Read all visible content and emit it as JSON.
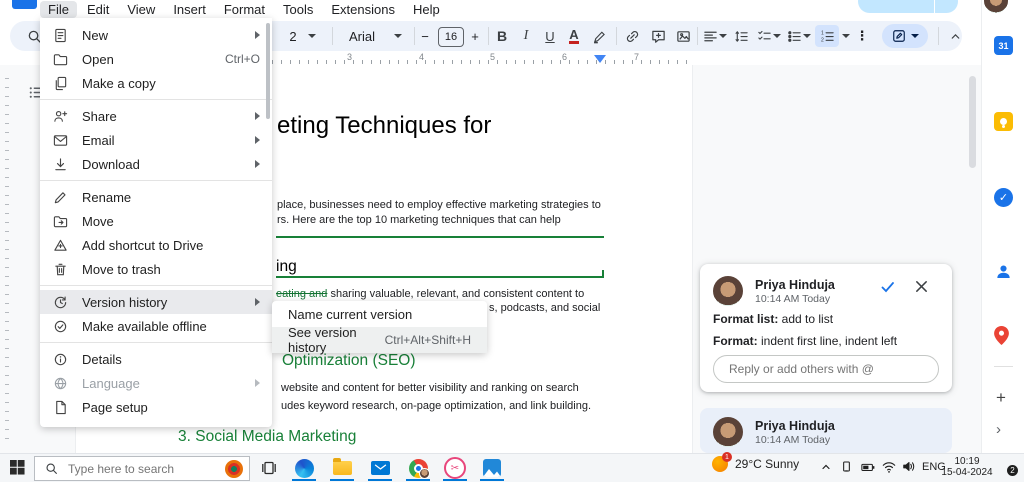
{
  "header": {
    "menu_items": [
      "File",
      "Edit",
      "View",
      "Insert",
      "Format",
      "Tools",
      "Extensions",
      "Help"
    ],
    "active_menu": "File"
  },
  "toolbar": {
    "style_value": "2",
    "font_name": "Arial",
    "font_size": "16",
    "minus_label": "−",
    "plus_label": "+",
    "bold_label": "B",
    "italic_label": "I",
    "underline_label": "U",
    "text_color_label": "A",
    "more_label": "⋮"
  },
  "ruler": {
    "marks": [
      "3",
      "4",
      "5",
      "6",
      "7"
    ]
  },
  "file_menu": {
    "items": [
      {
        "label": "New",
        "shortcut": "",
        "submenu": true
      },
      {
        "label": "Open",
        "shortcut": "Ctrl+O",
        "submenu": false
      },
      {
        "label": "Make a copy",
        "shortcut": "",
        "submenu": false
      },
      {
        "label": "Share",
        "shortcut": "",
        "submenu": true
      },
      {
        "label": "Email",
        "shortcut": "",
        "submenu": true
      },
      {
        "label": "Download",
        "shortcut": "",
        "submenu": true
      },
      {
        "label": "Rename",
        "shortcut": "",
        "submenu": false
      },
      {
        "label": "Move",
        "shortcut": "",
        "submenu": false
      },
      {
        "label": "Add shortcut to Drive",
        "shortcut": "",
        "submenu": false
      },
      {
        "label": "Move to trash",
        "shortcut": "",
        "submenu": false
      },
      {
        "label": "Version history",
        "shortcut": "",
        "submenu": true
      },
      {
        "label": "Make available offline",
        "shortcut": "",
        "submenu": false
      },
      {
        "label": "Details",
        "shortcut": "",
        "submenu": false
      },
      {
        "label": "Language",
        "shortcut": "",
        "submenu": true
      },
      {
        "label": "Page setup",
        "shortcut": "",
        "submenu": false
      }
    ],
    "highlighted_item": "Version history",
    "disabled_item": "Language"
  },
  "version_submenu": {
    "items": [
      {
        "label": "Name current version",
        "shortcut": ""
      },
      {
        "label": "See version history",
        "shortcut": "Ctrl+Alt+Shift+H"
      }
    ],
    "highlighted_item": "See version history"
  },
  "document": {
    "title_fragment": "eting Techniques for",
    "para1_line1": "place, businesses need to employ effective marketing strategies to",
    "para1_line2": "rs. Here are the top 10 marketing techniques that can help",
    "heading1_fragment": "ing",
    "strike_fragment": "eating and",
    "after_strike": " sharing valuable, relevant, and consistent content to",
    "body_line_fragment": "s, podcasts, and social",
    "heading2_fragment": "Optimization (SEO)",
    "para2_line1": "website and content for better visibility and ranking on search",
    "para2_line2": "udes keyword research, on-page optimization, and link building.",
    "heading3": "3. Social Media Marketing"
  },
  "comments": {
    "card1": {
      "author": "Priya Hinduja",
      "timestamp": "10:14 AM Today",
      "body_line1_bold": "Format list:",
      "body_line1_rest": " add to list",
      "body_line2_bold": "Format:",
      "body_line2_rest": " indent first line, indent left",
      "reply_placeholder": "Reply or add others with @"
    },
    "card2": {
      "author": "Priya Hinduja",
      "timestamp": "10:14 AM Today"
    }
  },
  "side_panel": {
    "calendar_label": "31",
    "tasks_check": "✓",
    "plus_label": "+",
    "collapse_chevron": "›"
  },
  "taskbar": {
    "search_placeholder": "Type here to search",
    "weather_badge": "1",
    "weather_text": "29°C Sunny",
    "language": "ENG",
    "time": "10:19",
    "date": "15-04-2024",
    "notification_count": "2",
    "scissors_glyph": "✂"
  },
  "colors": {
    "accent_blue": "#1a73e8",
    "toolbar_bg": "#edf2fa",
    "active_control_bg": "#d3e3fd",
    "suggestion_green": "#188038",
    "menu_highlight": "#e9eaed",
    "taskbar_underline": "#0078d7",
    "comment_selected_bg": "#e9eff9"
  }
}
